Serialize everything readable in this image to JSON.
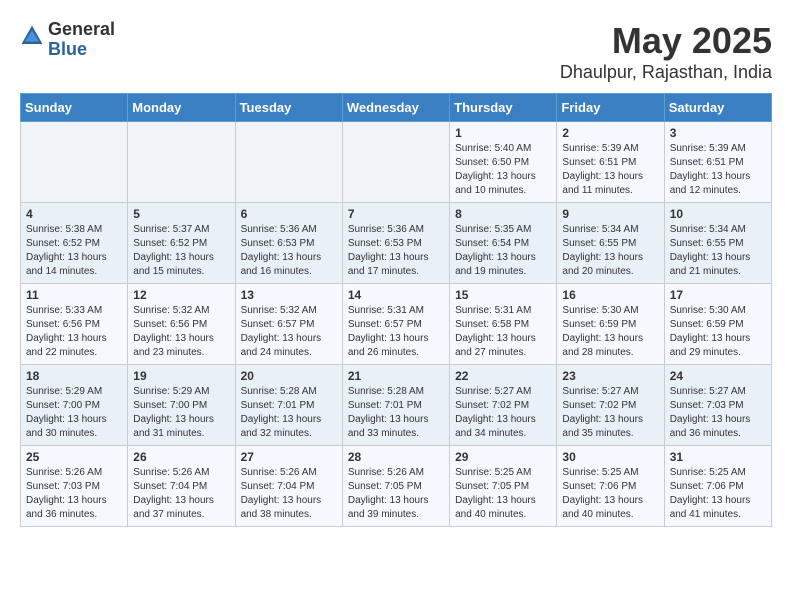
{
  "logo": {
    "general": "General",
    "blue": "Blue"
  },
  "title": {
    "month_year": "May 2025",
    "location": "Dhaulpur, Rajasthan, India"
  },
  "days_of_week": [
    "Sunday",
    "Monday",
    "Tuesday",
    "Wednesday",
    "Thursday",
    "Friday",
    "Saturday"
  ],
  "weeks": [
    [
      {
        "day": "",
        "info": ""
      },
      {
        "day": "",
        "info": ""
      },
      {
        "day": "",
        "info": ""
      },
      {
        "day": "",
        "info": ""
      },
      {
        "day": "1",
        "info": "Sunrise: 5:40 AM\nSunset: 6:50 PM\nDaylight: 13 hours\nand 10 minutes."
      },
      {
        "day": "2",
        "info": "Sunrise: 5:39 AM\nSunset: 6:51 PM\nDaylight: 13 hours\nand 11 minutes."
      },
      {
        "day": "3",
        "info": "Sunrise: 5:39 AM\nSunset: 6:51 PM\nDaylight: 13 hours\nand 12 minutes."
      }
    ],
    [
      {
        "day": "4",
        "info": "Sunrise: 5:38 AM\nSunset: 6:52 PM\nDaylight: 13 hours\nand 14 minutes."
      },
      {
        "day": "5",
        "info": "Sunrise: 5:37 AM\nSunset: 6:52 PM\nDaylight: 13 hours\nand 15 minutes."
      },
      {
        "day": "6",
        "info": "Sunrise: 5:36 AM\nSunset: 6:53 PM\nDaylight: 13 hours\nand 16 minutes."
      },
      {
        "day": "7",
        "info": "Sunrise: 5:36 AM\nSunset: 6:53 PM\nDaylight: 13 hours\nand 17 minutes."
      },
      {
        "day": "8",
        "info": "Sunrise: 5:35 AM\nSunset: 6:54 PM\nDaylight: 13 hours\nand 19 minutes."
      },
      {
        "day": "9",
        "info": "Sunrise: 5:34 AM\nSunset: 6:55 PM\nDaylight: 13 hours\nand 20 minutes."
      },
      {
        "day": "10",
        "info": "Sunrise: 5:34 AM\nSunset: 6:55 PM\nDaylight: 13 hours\nand 21 minutes."
      }
    ],
    [
      {
        "day": "11",
        "info": "Sunrise: 5:33 AM\nSunset: 6:56 PM\nDaylight: 13 hours\nand 22 minutes."
      },
      {
        "day": "12",
        "info": "Sunrise: 5:32 AM\nSunset: 6:56 PM\nDaylight: 13 hours\nand 23 minutes."
      },
      {
        "day": "13",
        "info": "Sunrise: 5:32 AM\nSunset: 6:57 PM\nDaylight: 13 hours\nand 24 minutes."
      },
      {
        "day": "14",
        "info": "Sunrise: 5:31 AM\nSunset: 6:57 PM\nDaylight: 13 hours\nand 26 minutes."
      },
      {
        "day": "15",
        "info": "Sunrise: 5:31 AM\nSunset: 6:58 PM\nDaylight: 13 hours\nand 27 minutes."
      },
      {
        "day": "16",
        "info": "Sunrise: 5:30 AM\nSunset: 6:59 PM\nDaylight: 13 hours\nand 28 minutes."
      },
      {
        "day": "17",
        "info": "Sunrise: 5:30 AM\nSunset: 6:59 PM\nDaylight: 13 hours\nand 29 minutes."
      }
    ],
    [
      {
        "day": "18",
        "info": "Sunrise: 5:29 AM\nSunset: 7:00 PM\nDaylight: 13 hours\nand 30 minutes."
      },
      {
        "day": "19",
        "info": "Sunrise: 5:29 AM\nSunset: 7:00 PM\nDaylight: 13 hours\nand 31 minutes."
      },
      {
        "day": "20",
        "info": "Sunrise: 5:28 AM\nSunset: 7:01 PM\nDaylight: 13 hours\nand 32 minutes."
      },
      {
        "day": "21",
        "info": "Sunrise: 5:28 AM\nSunset: 7:01 PM\nDaylight: 13 hours\nand 33 minutes."
      },
      {
        "day": "22",
        "info": "Sunrise: 5:27 AM\nSunset: 7:02 PM\nDaylight: 13 hours\nand 34 minutes."
      },
      {
        "day": "23",
        "info": "Sunrise: 5:27 AM\nSunset: 7:02 PM\nDaylight: 13 hours\nand 35 minutes."
      },
      {
        "day": "24",
        "info": "Sunrise: 5:27 AM\nSunset: 7:03 PM\nDaylight: 13 hours\nand 36 minutes."
      }
    ],
    [
      {
        "day": "25",
        "info": "Sunrise: 5:26 AM\nSunset: 7:03 PM\nDaylight: 13 hours\nand 36 minutes."
      },
      {
        "day": "26",
        "info": "Sunrise: 5:26 AM\nSunset: 7:04 PM\nDaylight: 13 hours\nand 37 minutes."
      },
      {
        "day": "27",
        "info": "Sunrise: 5:26 AM\nSunset: 7:04 PM\nDaylight: 13 hours\nand 38 minutes."
      },
      {
        "day": "28",
        "info": "Sunrise: 5:26 AM\nSunset: 7:05 PM\nDaylight: 13 hours\nand 39 minutes."
      },
      {
        "day": "29",
        "info": "Sunrise: 5:25 AM\nSunset: 7:05 PM\nDaylight: 13 hours\nand 40 minutes."
      },
      {
        "day": "30",
        "info": "Sunrise: 5:25 AM\nSunset: 7:06 PM\nDaylight: 13 hours\nand 40 minutes."
      },
      {
        "day": "31",
        "info": "Sunrise: 5:25 AM\nSunset: 7:06 PM\nDaylight: 13 hours\nand 41 minutes."
      }
    ]
  ]
}
